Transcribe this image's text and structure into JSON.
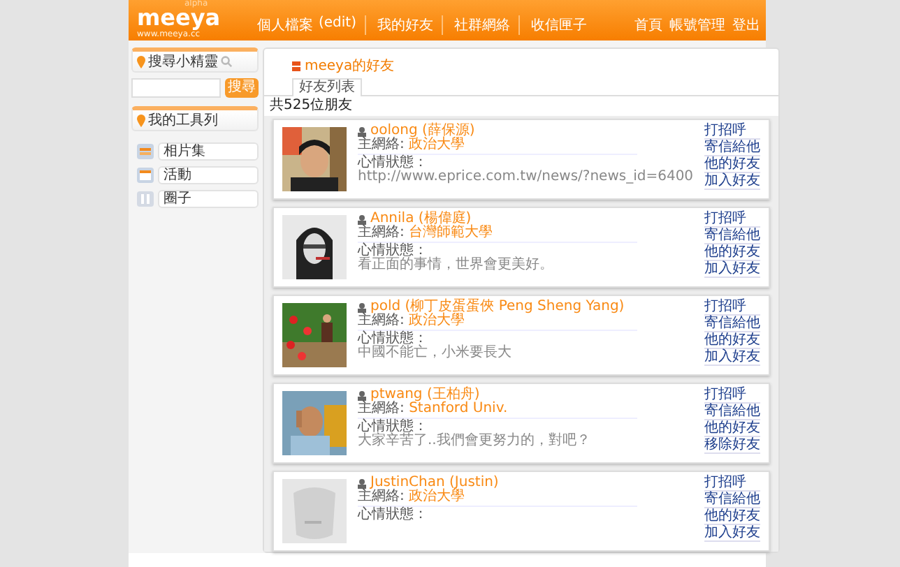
{
  "header": {
    "logo": "meeya",
    "logo_tag": "alpha",
    "logo_url": "www.meeya.cc",
    "nav": [
      {
        "label": "個人檔案"
      },
      {
        "label": "(edit)"
      },
      {
        "label": "我的好友"
      },
      {
        "label": "社群網絡"
      },
      {
        "label": "收信匣子"
      }
    ],
    "account_links": [
      "首頁",
      "帳號管理",
      "登出"
    ]
  },
  "sidebar": {
    "search": {
      "title": "搜尋小精靈",
      "button": "搜尋"
    },
    "toolbar": {
      "title": "我的工具列",
      "items": [
        {
          "label": "相片集",
          "kind": "album"
        },
        {
          "label": "活動",
          "kind": "event"
        },
        {
          "label": "圈子",
          "kind": "circle"
        }
      ]
    }
  },
  "main": {
    "title": "meeya的好友",
    "tabs": [
      {
        "label": "好友列表",
        "selected": true
      }
    ],
    "count": "共525位朋友",
    "friends": [
      {
        "name": "oolong (薛保源)",
        "network_label": "主網絡:",
        "network": "政治大學",
        "mood_label": "心情狀態：",
        "mood": "http://www.eprice.com.tw/news/?news_id=6400",
        "actions": [
          "打招呼",
          "寄信給他",
          "他的好友",
          "加入好友"
        ]
      },
      {
        "name": "Annila (楊偉庭)",
        "network_label": "主網絡:",
        "network": "台灣師範大學",
        "mood_label": "心情狀態：",
        "mood": "看正面的事情，世界會更美好。",
        "actions": [
          "打招呼",
          "寄信給他",
          "他的好友",
          "加入好友"
        ]
      },
      {
        "name": "pold (柳丁皮蛋蛋俠 Peng Sheng Yang)",
        "network_label": "主網絡:",
        "network": "政治大學",
        "mood_label": "心情狀態：",
        "mood": "中國不能亡，小米要長大",
        "actions": [
          "打招呼",
          "寄信給他",
          "他的好友",
          "加入好友"
        ]
      },
      {
        "name": "ptwang (王柏舟)",
        "network_label": "主網絡:",
        "network": "Stanford Univ.",
        "mood_label": "心情狀態：",
        "mood": "大家辛苦了..我們會更努力的，對吧？",
        "actions": [
          "打招呼",
          "寄信給他",
          "他的好友",
          "移除好友"
        ]
      },
      {
        "name": "JustinChan (Justin)",
        "network_label": "主網絡:",
        "network": "政治大學",
        "mood_label": "心情狀態：",
        "actions": [
          "打招呼",
          "寄信給他",
          "他的好友",
          "加入好友"
        ]
      }
    ]
  }
}
